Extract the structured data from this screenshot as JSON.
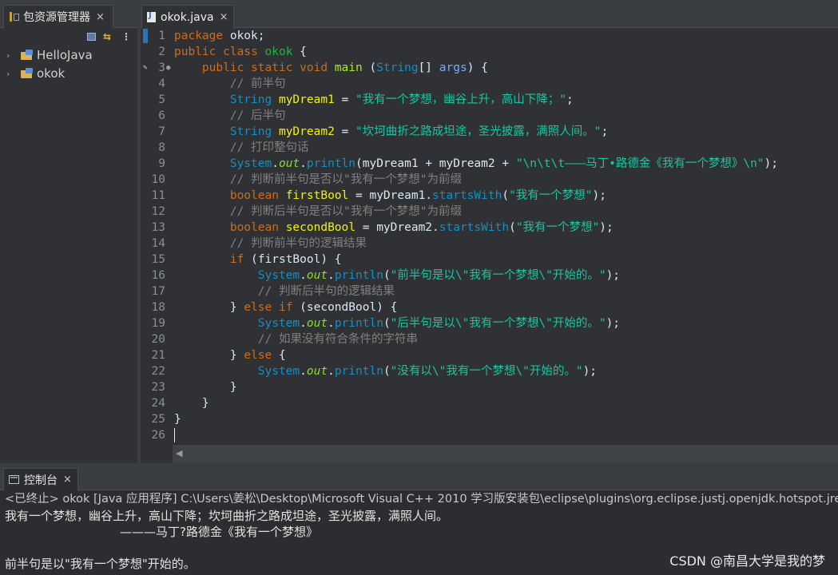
{
  "package_explorer": {
    "tab_label": "包资源管理器",
    "close_symbol": "×",
    "projects": [
      {
        "label": "HelloJava"
      },
      {
        "label": "okok"
      }
    ]
  },
  "editor": {
    "tab_label": "okok.java",
    "close_symbol": "×",
    "line_numbers": [
      "1",
      "2",
      "3",
      "4",
      "5",
      "6",
      "7",
      "8",
      "9",
      "10",
      "11",
      "12",
      "13",
      "14",
      "15",
      "16",
      "17",
      "18",
      "19",
      "20",
      "21",
      "22",
      "23",
      "24",
      "25",
      "26"
    ],
    "strings": {
      "dream1": "\"我有一个梦想，幽谷上升，高山下降；\"",
      "dream2": "\"坎坷曲折之路成坦途，圣光披露，满照人间。\"",
      "println_tail": "\"\\n\\t\\t———马丁•路德金《我有一个梦想》\\n\"",
      "prefix": "\"我有一个梦想\"",
      "msg1": "\"前半句是以\\\"我有一个梦想\\\"开始的。\"",
      "msg2": "\"后半句是以\\\"我有一个梦想\\\"开始的。\"",
      "msg3": "\"没有以\\\"我有一个梦想\\\"开始的。\""
    },
    "comments": {
      "c4": "// 前半句",
      "c6": "// 后半句",
      "c8": "// 打印整句话",
      "c10": "// 判断前半句是否以\"我有一个梦想\"为前缀",
      "c12": "// 判断后半句是否以\"我有一个梦想\"为前缀",
      "c14": "// 判断前半句的逻辑结果",
      "c17": "// 判断后半句的逻辑结果",
      "c20": "// 如果没有符合条件的字符串"
    }
  },
  "console": {
    "tab_label": "控制台",
    "close_symbol": "×",
    "status": "<已终止> okok [Java 应用程序] C:\\Users\\姜松\\Desktop\\Microsoft Visual C++ 2010 学习版安装包\\eclipse\\plugins\\org.eclipse.justj.openjdk.hotspot.jre",
    "output": [
      "我有一个梦想，幽谷上升，高山下降；坎坷曲折之路成坦途，圣光披露，满照人间。",
      "\t\t———马丁?路德金《我有一个梦想》",
      "",
      "前半句是以\"我有一个梦想\"开始的。"
    ]
  },
  "watermark": "CSDN @南昌大学是我的梦"
}
